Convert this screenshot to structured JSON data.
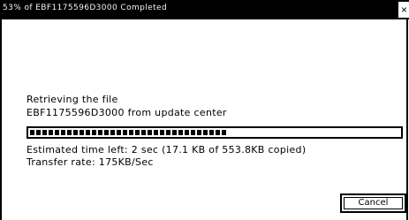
{
  "window": {
    "title": "53% of EBF1175596D3000 Completed"
  },
  "content": {
    "status_line": "Retrieving the file",
    "file_line": "EBF1175596D3000 from update center",
    "progress": 0.53,
    "estimate_line": "Estimated time left: 2 sec (17.1 KB of 553.8KB copied)",
    "rate_line": "Transfer rate:      175KB/Sec"
  },
  "buttons": {
    "cancel": "Cancel"
  }
}
